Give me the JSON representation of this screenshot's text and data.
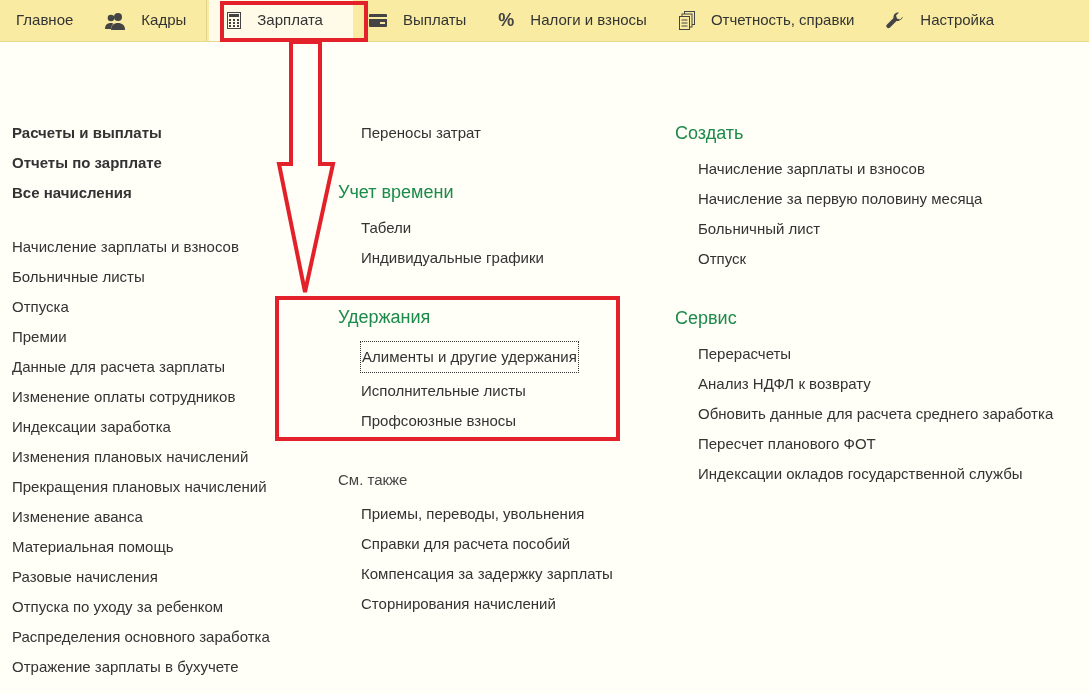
{
  "sections_bar": [
    {
      "label": "Главное",
      "kind": "plain",
      "selected": false
    },
    {
      "label": "Кадры",
      "kind": "people",
      "selected": false
    },
    {
      "label": "Зарплата",
      "kind": "calculator",
      "selected": true
    },
    {
      "label": "Выплаты",
      "kind": "card",
      "selected": false
    },
    {
      "label": "Налоги и взносы",
      "kind": "glyph",
      "glyph": "%",
      "selected": false
    },
    {
      "label": "Отчетность, справки",
      "kind": "documents",
      "selected": false
    },
    {
      "label": "Настройка",
      "kind": "wrench",
      "selected": false
    }
  ],
  "left_column": {
    "main_links": [
      "Расчеты и выплаты",
      "Отчеты по зарплате",
      "Все начисления"
    ],
    "links": [
      "Начисление зарплаты и взносов",
      "Больничные листы",
      "Отпуска",
      "Премии",
      "Данные для расчета зарплаты",
      "Изменение оплаты сотрудников",
      "Индексации заработка",
      "Изменения плановых начислений",
      "Прекращения плановых начислений",
      "Изменение аванса",
      "Материальная помощь",
      "Разовые начисления",
      "Отпуска по уходу за ребенком",
      "Распределения основного заработка",
      "Отражение зарплаты в бухучете"
    ]
  },
  "middle_column": [
    {
      "kind": "untitled",
      "items": [
        {
          "label": "Переносы затрат",
          "focused": false
        }
      ]
    },
    {
      "kind": "group",
      "title": "Учет времени",
      "items": [
        {
          "label": "Табели",
          "focused": false
        },
        {
          "label": "Индивидуальные графики",
          "focused": false
        }
      ]
    },
    {
      "kind": "group",
      "title": "Удержания",
      "items": [
        {
          "label": "Алименты и другие удержания",
          "focused": true
        },
        {
          "label": "Исполнительные листы",
          "focused": false
        },
        {
          "label": "Профсоюзные взносы",
          "focused": false
        }
      ]
    },
    {
      "kind": "see_also",
      "title": "См. также",
      "items": [
        {
          "label": "Приемы, переводы, увольнения",
          "focused": false
        },
        {
          "label": "Справки для расчета пособий",
          "focused": false
        },
        {
          "label": "Компенсация за задержку зарплаты",
          "focused": false
        },
        {
          "label": "Сторнирования начислений",
          "focused": false
        }
      ]
    }
  ],
  "right_column": [
    {
      "kind": "group",
      "title": "Создать",
      "items": [
        {
          "label": "Начисление зарплаты и взносов",
          "focused": false
        },
        {
          "label": "Начисление за первую половину месяца",
          "focused": false
        },
        {
          "label": "Больничный лист",
          "focused": false
        },
        {
          "label": "Отпуск",
          "focused": false
        }
      ]
    },
    {
      "kind": "group",
      "title": "Сервис",
      "items": [
        {
          "label": "Перерасчеты",
          "focused": false
        },
        {
          "label": "Анализ НДФЛ к возврату",
          "focused": false
        },
        {
          "label": "Обновить данные для расчета среднего заработка",
          "focused": false
        },
        {
          "label": "Пересчет планового ФОТ",
          "focused": false
        },
        {
          "label": "Индексации окладов государственной службы",
          "focused": false
        }
      ]
    }
  ]
}
